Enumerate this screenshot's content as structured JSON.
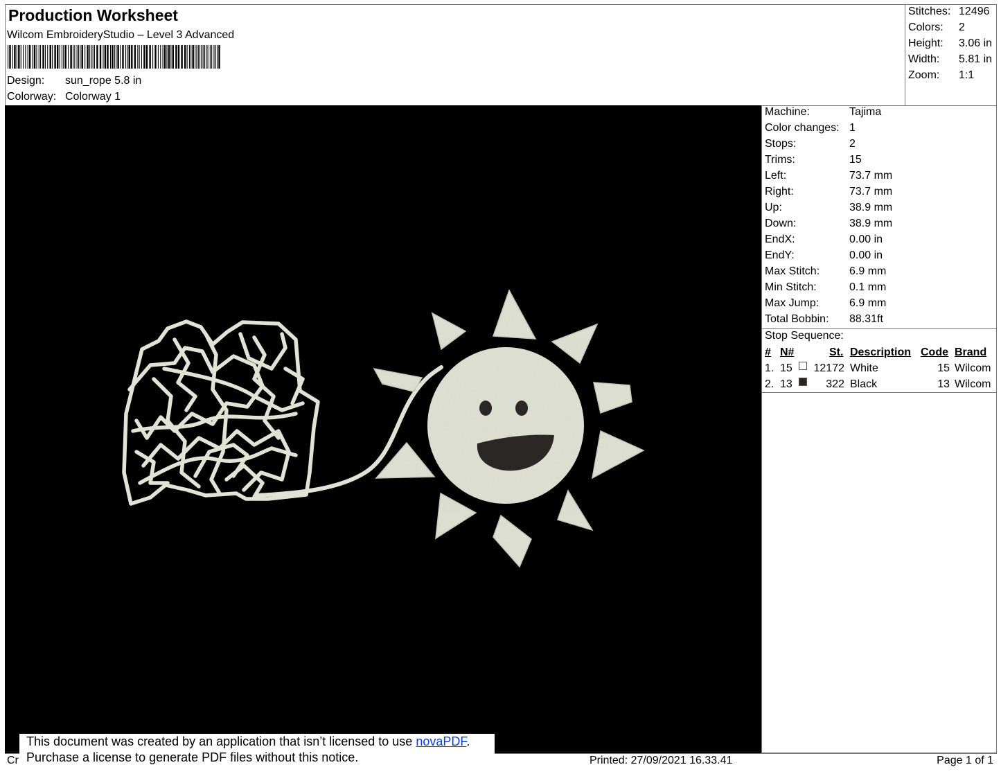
{
  "header": {
    "title": "Production Worksheet",
    "software": "Wilcom EmbroideryStudio – Level 3 Advanced",
    "design_label": "Design:",
    "design_value": "sun_rope 5.8 in",
    "colorway_label": "Colorway:",
    "colorway_value": "Colorway 1"
  },
  "summary": [
    {
      "label": "Stitches:",
      "value": "12496"
    },
    {
      "label": "Colors:",
      "value": "2"
    },
    {
      "label": "Height:",
      "value": "3.06 in"
    },
    {
      "label": "Width:",
      "value": "5.81 in"
    },
    {
      "label": "Zoom:",
      "value": "1:1"
    }
  ],
  "machine_info": [
    {
      "label": "Machine:",
      "value": "Tajima"
    },
    {
      "label": "Color changes:",
      "value": "1"
    },
    {
      "label": "Stops:",
      "value": "2"
    },
    {
      "label": "Trims:",
      "value": "15"
    },
    {
      "label": "Left:",
      "value": "73.7 mm"
    },
    {
      "label": "Right:",
      "value": "73.7 mm"
    },
    {
      "label": "Up:",
      "value": "38.9 mm"
    },
    {
      "label": "Down:",
      "value": "38.9 mm"
    },
    {
      "label": "EndX:",
      "value": "0.00 in"
    },
    {
      "label": "EndY:",
      "value": "0.00 in"
    },
    {
      "label": "Max Stitch:",
      "value": "6.9 mm"
    },
    {
      "label": "Min Stitch:",
      "value": "0.1 mm"
    },
    {
      "label": "Max Jump:",
      "value": "6.9 mm"
    },
    {
      "label": "Total Bobbin:",
      "value": "88.31ft"
    }
  ],
  "stop_sequence": {
    "title": "Stop Sequence:",
    "headers": {
      "num": "#",
      "needle": "N#",
      "st": "St.",
      "desc": "Description",
      "code": "Code",
      "brand": "Brand"
    },
    "rows": [
      {
        "num": "1.",
        "needle": "15",
        "swatch": "#ffffff",
        "st": "12172",
        "desc": "White",
        "code": "15",
        "brand": "Wilcom"
      },
      {
        "num": "2.",
        "needle": "13",
        "swatch": "#2a2420",
        "st": "322",
        "desc": "Black",
        "code": "13",
        "brand": "Wilcom"
      }
    ]
  },
  "colors": {
    "thread_main": "#e4e6da",
    "thread_dark": "#2b2724",
    "background": "#000000"
  },
  "footer": {
    "notice_line1_pre": "This document was created by an application that isn’t licensed to use ",
    "notice_link": "novaPDF",
    "notice_line1_post": ".",
    "notice_line2": "Purchase a license to generate PDF files without this notice.",
    "left_cut": "Cr",
    "printed": "Printed: 27/09/2021 16.33.41",
    "page": "Page 1 of 1"
  }
}
